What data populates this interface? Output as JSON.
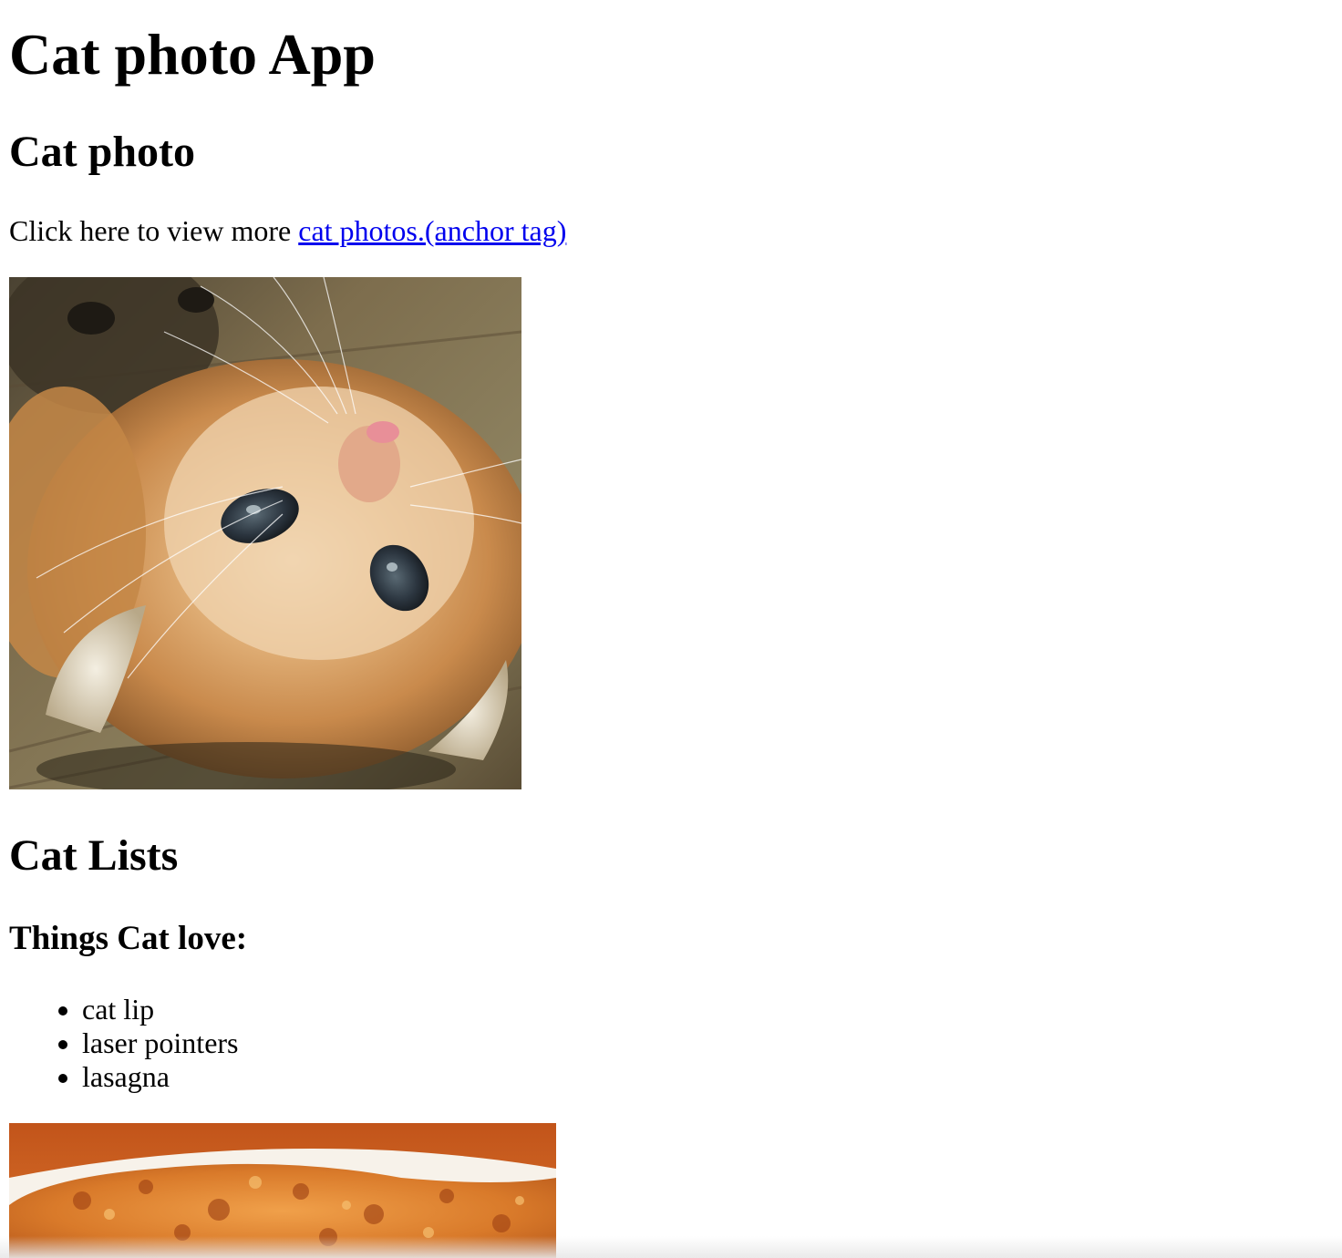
{
  "page": {
    "title": "Cat photo App",
    "photo_section": {
      "heading": "Cat photo",
      "intro_text": "Click here to view more ",
      "link_text": "cat photos.(anchor tag)",
      "link_color": "#0000EE"
    },
    "lists_section": {
      "heading": "Cat Lists",
      "subheading": "Things Cat love:",
      "items": [
        "cat lip",
        "laser pointers",
        "lasagna"
      ]
    }
  }
}
